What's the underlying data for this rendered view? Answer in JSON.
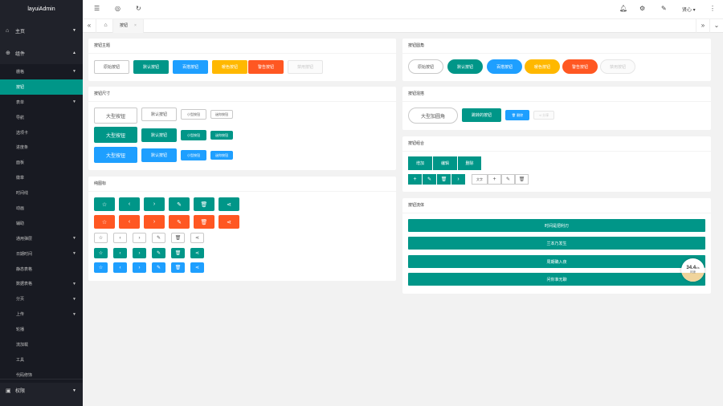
{
  "app": {
    "title": "layuiAdmin"
  },
  "sidebar": {
    "home": "主页",
    "components": "组件",
    "items": [
      {
        "label": "栅格",
        "arrow": true
      },
      {
        "label": "按钮",
        "active": true
      },
      {
        "label": "表单",
        "arrow": true
      },
      {
        "label": "导航"
      },
      {
        "label": "选项卡"
      },
      {
        "label": "进度条"
      },
      {
        "label": "面板"
      },
      {
        "label": "徽章"
      },
      {
        "label": "时间线"
      },
      {
        "label": "动画"
      },
      {
        "label": "辅助"
      },
      {
        "label": "通用弹层",
        "arrow": true
      },
      {
        "label": "日期时间",
        "arrow": true
      },
      {
        "label": "静态表格"
      },
      {
        "label": "数据表格",
        "arrow": true
      },
      {
        "label": "分页",
        "arrow": true
      },
      {
        "label": "上传",
        "arrow": true
      },
      {
        "label": "轮播"
      },
      {
        "label": "流加载"
      },
      {
        "label": "工具"
      },
      {
        "label": "代码修饰"
      }
    ],
    "permissions": "权限"
  },
  "tabs": {
    "active": "按钮",
    "close": "×"
  },
  "topbar": {
    "user": "贤心"
  },
  "cards": {
    "theme": {
      "title": "按钮主题",
      "buttons": [
        "原始按钮",
        "默认按钮",
        "百搭按钮",
        "暖色按钮",
        "警告按钮",
        "禁用按钮"
      ]
    },
    "size": {
      "title": "按钮尺寸",
      "rows": [
        [
          "大型按钮",
          "默认按钮",
          "小型按钮",
          "迷你按钮"
        ],
        [
          "大型按钮",
          "默认按钮",
          "小型按钮",
          "迷你按钮"
        ],
        [
          "大型按钮",
          "默认按钮",
          "小型按钮",
          "迷你按钮"
        ]
      ]
    },
    "icon": {
      "title": "纯图标"
    },
    "round": {
      "title": "按钮圆角",
      "buttons": [
        "原始按钮",
        "默认按钮",
        "百搭按钮",
        "暖色按钮",
        "警告按钮",
        "禁用按钮"
      ]
    },
    "mix": {
      "title": "按钮混搭",
      "large": "大型加圆角",
      "icon_btn": "跳转的按钮",
      "small": "删除",
      "mini": "分享"
    },
    "group": {
      "title": "按钮组合",
      "row1": [
        "增加",
        "编辑",
        "删除"
      ],
      "text": "文字"
    },
    "fluid": {
      "title": "按钮流体",
      "rows": [
        "时间是把利刃",
        "兰本乃发生",
        "周期确入夜",
        "问你准无聊"
      ]
    }
  },
  "monitor": {
    "speed": "34.4",
    "unit": "k/s",
    "label": "网速"
  },
  "colors": {
    "accent": "#009688",
    "normal": "#1e9fff",
    "warm": "#ffb800",
    "danger": "#ff5722",
    "sidebar": "#20222a"
  }
}
